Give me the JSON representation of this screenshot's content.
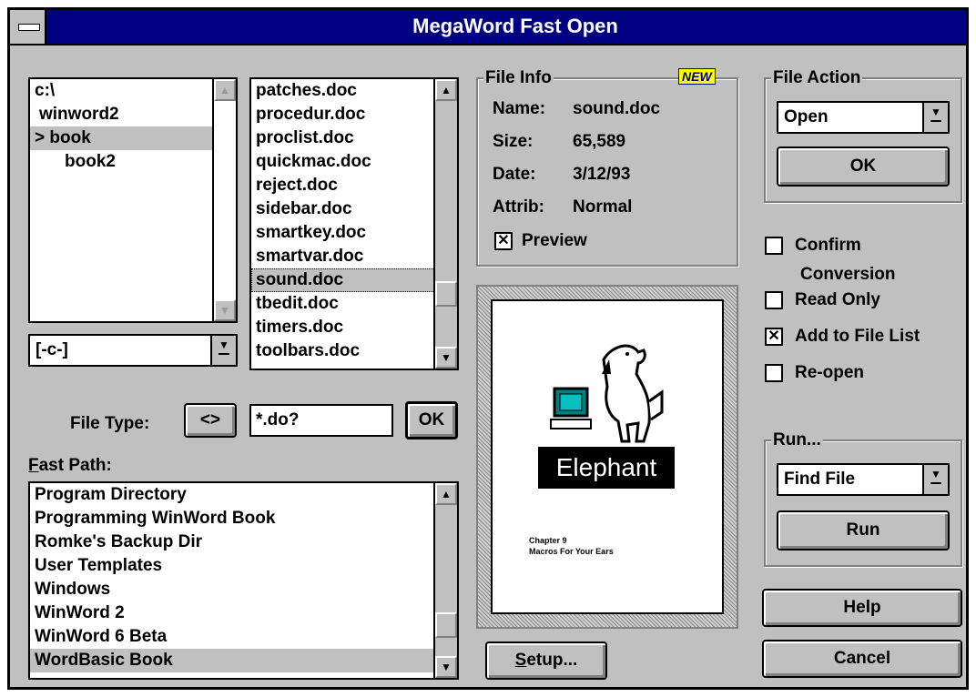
{
  "window": {
    "title": "MegaWord Fast Open"
  },
  "dir_list": {
    "items": [
      "c:\\",
      "winword2",
      "> book",
      "book2"
    ]
  },
  "drive_select": {
    "value": "[-c-]"
  },
  "file_list": {
    "items": [
      "patches.doc",
      "procedur.doc",
      "proclist.doc",
      "quickmac.doc",
      "reject.doc",
      "sidebar.doc",
      "smartkey.doc",
      "smartvar.doc",
      "sound.doc",
      "tbedit.doc",
      "timers.doc",
      "toolbars.doc"
    ]
  },
  "file_type": {
    "label": "File Type:",
    "toggle_label": "<>",
    "value": "*.do?",
    "ok_label": "OK"
  },
  "fast_path": {
    "label": "Fast Path:",
    "items": [
      "Program Directory",
      "Programming WinWord Book",
      "Romke's Backup Dir",
      "User Templates",
      "Windows",
      "WinWord 2",
      "WinWord 6 Beta",
      "WordBasic Book"
    ]
  },
  "file_info": {
    "title": "File Info",
    "badge": "NEW",
    "name_label": "Name:",
    "name": "sound.doc",
    "size_label": "Size:",
    "size": "65,589",
    "date_label": "Date:",
    "date": "3/12/93",
    "attrib_label": "Attrib:",
    "attrib": "Normal",
    "preview_label": "Preview",
    "preview_checked": true
  },
  "preview_page": {
    "banner": "Elephant",
    "caption_line1": "Chapter 9",
    "caption_line2": "Macros For Your Ears"
  },
  "file_action": {
    "title": "File Action",
    "value": "Open",
    "ok_label": "OK"
  },
  "options": {
    "confirm_line1": "Confirm",
    "confirm_line2": "Conversion",
    "read_only": "Read Only",
    "add_to_list": "Add to File List",
    "reopen": "Re-open",
    "confirm_checked": false,
    "read_only_checked": false,
    "add_to_list_checked": true,
    "reopen_checked": false
  },
  "run": {
    "title": "Run...",
    "value": "Find File",
    "run_label": "Run"
  },
  "buttons": {
    "setup": "Setup...",
    "help": "Help",
    "cancel": "Cancel"
  },
  "colors": {
    "titlebar": "#000080",
    "face": "#c0c0c0"
  }
}
